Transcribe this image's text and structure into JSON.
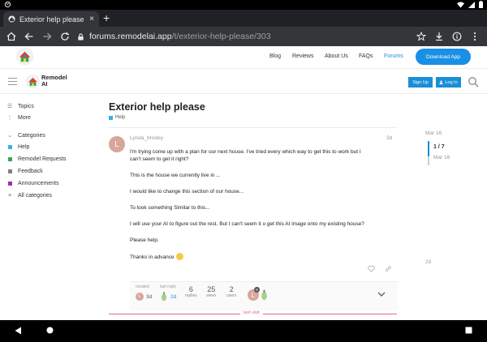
{
  "status_bar": {
    "left_icon": "android-debug-icon",
    "right_icons": [
      "wifi-icon",
      "signal-icon",
      "battery-icon"
    ]
  },
  "browser": {
    "tab": {
      "title": "Exterior help please -",
      "close_glyph": "×",
      "favicon": "remodelai-favicon"
    },
    "new_tab_glyph": "+",
    "address": {
      "domain": "forums.remodelai.app",
      "path": "/t/exterior-help-please/303"
    },
    "toolbar_icons": [
      "home-icon",
      "back-icon",
      "forward-icon",
      "star-icon",
      "download-icon",
      "info-icon",
      "more-icon"
    ]
  },
  "site_nav": {
    "links": [
      "Blog",
      "Reviews",
      "About Us",
      "FAQs",
      "Forums"
    ],
    "active": "Forums",
    "download_label": "Download App"
  },
  "forum_header": {
    "brand_line1": "Remodel",
    "brand_line2": "AI",
    "signup_label": "Sign Up",
    "login_label": "Log In"
  },
  "sidebar": {
    "topics": "Topics",
    "more": "More",
    "categories_heading": "Categories",
    "categories": [
      {
        "label": "Help",
        "color": "#3ab0e0"
      },
      {
        "label": "Remodel Requests",
        "color": "#3aa64b"
      },
      {
        "label": "Feedback",
        "color": "#808080"
      },
      {
        "label": "Announcements",
        "color": "#9b2fae"
      }
    ],
    "all_categories": "All categories"
  },
  "topic": {
    "title": "Exterior help please",
    "category": "Help",
    "category_color": "#3ab0e0"
  },
  "post": {
    "avatar_letter": "L",
    "username": "Lynda_brodey",
    "date": "3d",
    "paragraphs": [
      "I'm trying come up with a plan for our next house. I've tried every which way to get this to work but I",
      "can't seem to get it right?",
      "This is the house we currently live in ...",
      "I would like to change this section of our house...",
      "To look something Similar to this...",
      "I will use your AI to figure out the rest. But I can't seem it o get this AI image onto my existing house?",
      "Please help.",
      "Thanks in advance"
    ]
  },
  "topic_map": {
    "created_label": "created",
    "created_value": "3d",
    "last_reply_label": "last reply",
    "last_reply_value": "2d",
    "replies": {
      "num": "6",
      "label": "replies"
    },
    "views": {
      "num": "25",
      "label": "views"
    },
    "users": {
      "num": "2",
      "label": "users"
    },
    "participant_badge": "5"
  },
  "last_visit_label": "last visit",
  "timeline": {
    "start": "Mar 16",
    "position": "1 / 7",
    "current_date": "Mar 16",
    "end": "2d",
    "progress": 0.14
  }
}
